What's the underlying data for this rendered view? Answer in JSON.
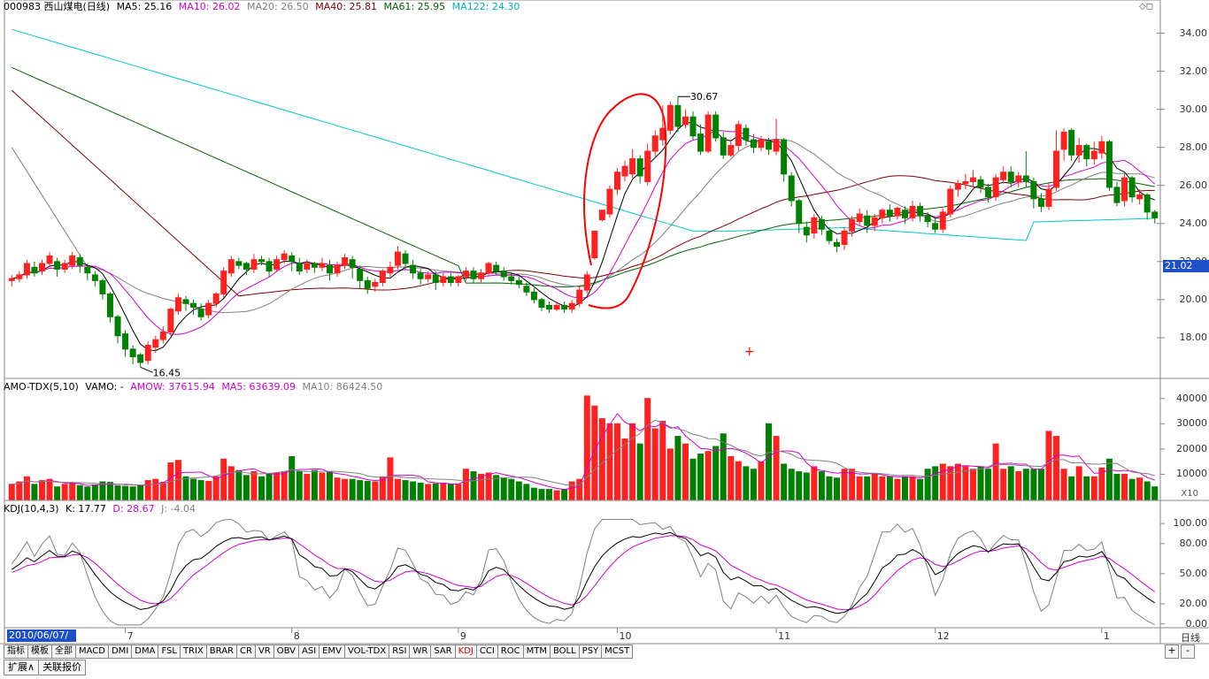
{
  "header": {
    "code_name": "000983 西山煤电(日线)",
    "ma5": "MA5: 25.16",
    "ma10": "MA10: 26.02",
    "ma20": "MA20: 26.50",
    "ma40": "MA40: 25.81",
    "ma61": "MA61: 25.95",
    "ma122": "MA122: 24.30"
  },
  "volume_header": {
    "name": "AMO-TDX(5,10)",
    "vamo": "VAMO: -",
    "amow": "AMOW: 37615.94",
    "ma5": "MA5: 63639.09",
    "ma10": "MA10: 86424.50"
  },
  "kdj_header": {
    "name": "KDJ(10,4,3)",
    "k": "K: 17.77",
    "d": "D: 28.67",
    "j": "J: -4.04"
  },
  "price_axis": [
    "34.00",
    "32.00",
    "30.00",
    "28.00",
    "26.00",
    "24.00",
    "22.00",
    "20.00",
    "18.00"
  ],
  "current_price": "21.02",
  "high_label": "30.67",
  "low_label": "16.45",
  "volume_axis": [
    "40000",
    "30000",
    "20000",
    "10000"
  ],
  "volume_unit": "X10",
  "kdj_axis": [
    "100.00",
    "80.00",
    "50.00",
    "20.00",
    "0.00"
  ],
  "x_months": [
    "7",
    "8",
    "9",
    "10",
    "11",
    "12",
    "1"
  ],
  "start_date": "2010/06/07/—",
  "period_label": "日线",
  "indicator_tabs": [
    "指标",
    "模板",
    "全部",
    "MACD",
    "DMI",
    "DMA",
    "FSL",
    "TRIX",
    "BRAR",
    "CR",
    "VR",
    "OBV",
    "ASI",
    "EMV",
    "VOL-TDX",
    "RSI",
    "WR",
    "SAR",
    "KDJ",
    "CCI",
    "ROC",
    "MTM",
    "BOLL",
    "PSY",
    "MCST"
  ],
  "active_tab": "KDJ",
  "bottom_tabs": [
    "扩展∧",
    "关联报价"
  ],
  "right_controls": [
    "+",
    "-"
  ],
  "colors": {
    "up": "#ff2020",
    "down": "#008000",
    "ma5": "#000000",
    "ma10": "#d000d0",
    "ma20": "#808080",
    "ma40": "#800000",
    "ma61": "#006400",
    "ma122": "#00c8d0",
    "accent": "#1e50c8"
  },
  "chart_data": {
    "type": "candlestick",
    "title": "000983 西山煤电(日线)",
    "ylim": [
      16,
      35
    ],
    "candles": [
      [
        21.0,
        21.1,
        20.7,
        21.3
      ],
      [
        21.1,
        21.3,
        20.9,
        21.5
      ],
      [
        21.3,
        21.9,
        21.1,
        22.1
      ],
      [
        21.7,
        21.4,
        21.2,
        22.0
      ],
      [
        21.5,
        21.9,
        21.3,
        22.1
      ],
      [
        21.9,
        22.3,
        21.7,
        22.5
      ],
      [
        22.0,
        21.6,
        21.2,
        22.2
      ],
      [
        21.6,
        21.9,
        21.4,
        22.1
      ],
      [
        21.8,
        22.3,
        21.6,
        22.5
      ],
      [
        22.2,
        21.8,
        21.4,
        22.4
      ],
      [
        21.7,
        21.4,
        21.0,
        21.9
      ],
      [
        21.3,
        21.0,
        20.7,
        21.5
      ],
      [
        21.0,
        20.3,
        20.0,
        21.1
      ],
      [
        20.3,
        19.1,
        18.8,
        20.4
      ],
      [
        19.1,
        18.1,
        17.7,
        19.2
      ],
      [
        18.2,
        17.4,
        17.0,
        18.4
      ],
      [
        17.4,
        17.0,
        16.6,
        17.6
      ],
      [
        17.1,
        16.7,
        16.45,
        17.2
      ],
      [
        16.8,
        17.6,
        16.6,
        17.8
      ],
      [
        17.5,
        17.9,
        17.2,
        18.1
      ],
      [
        17.9,
        18.3,
        17.7,
        18.6
      ],
      [
        18.3,
        19.5,
        18.1,
        19.6
      ],
      [
        19.4,
        20.1,
        19.2,
        20.3
      ],
      [
        20.0,
        19.8,
        19.4,
        20.2
      ],
      [
        19.8,
        19.6,
        19.2,
        20.0
      ],
      [
        19.5,
        19.1,
        18.9,
        19.8
      ],
      [
        19.2,
        19.8,
        19.0,
        20.0
      ],
      [
        19.8,
        20.3,
        19.6,
        20.4
      ],
      [
        20.3,
        21.5,
        20.1,
        21.7
      ],
      [
        21.4,
        22.1,
        21.2,
        22.3
      ],
      [
        22.0,
        21.8,
        21.6,
        22.2
      ],
      [
        21.9,
        21.6,
        21.3,
        22.0
      ],
      [
        21.6,
        22.1,
        21.4,
        22.4
      ],
      [
        22.1,
        22.0,
        21.8,
        22.3
      ],
      [
        22.0,
        21.5,
        21.2,
        22.2
      ],
      [
        21.6,
        22.1,
        21.5,
        22.3
      ],
      [
        22.1,
        22.4,
        21.9,
        22.6
      ],
      [
        22.3,
        22.0,
        21.5,
        22.5
      ],
      [
        21.9,
        21.5,
        21.3,
        22.2
      ],
      [
        21.6,
        21.9,
        21.4,
        22.1
      ],
      [
        21.9,
        21.7,
        21.4,
        22.0
      ],
      [
        21.7,
        21.9,
        21.5,
        22.2
      ],
      [
        21.8,
        21.4,
        21.0,
        22.1
      ],
      [
        21.4,
        21.8,
        21.2,
        22.0
      ],
      [
        21.8,
        22.2,
        21.6,
        22.4
      ],
      [
        22.1,
        21.7,
        21.1,
        22.3
      ],
      [
        21.6,
        21.0,
        20.6,
        21.8
      ],
      [
        21.0,
        20.6,
        20.3,
        21.2
      ],
      [
        20.7,
        20.9,
        20.4,
        21.1
      ],
      [
        20.9,
        21.5,
        20.7,
        21.6
      ],
      [
        21.4,
        21.7,
        21.2,
        22.0
      ],
      [
        21.8,
        22.5,
        21.6,
        22.8
      ],
      [
        22.4,
        21.9,
        21.6,
        22.6
      ],
      [
        21.8,
        21.4,
        21.1,
        22.1
      ],
      [
        21.4,
        21.1,
        20.8,
        21.6
      ],
      [
        21.1,
        21.3,
        20.9,
        21.5
      ],
      [
        21.3,
        20.9,
        20.5,
        21.5
      ],
      [
        20.9,
        21.2,
        20.7,
        21.4
      ],
      [
        21.2,
        20.9,
        20.7,
        21.4
      ],
      [
        20.9,
        21.2,
        20.7,
        21.3
      ],
      [
        21.2,
        21.5,
        21.0,
        21.7
      ],
      [
        21.5,
        21.1,
        20.9,
        21.7
      ],
      [
        21.1,
        21.4,
        20.9,
        21.6
      ],
      [
        21.4,
        21.9,
        21.2,
        22.0
      ],
      [
        21.8,
        21.5,
        21.3,
        22.0
      ],
      [
        21.5,
        21.2,
        21.0,
        21.7
      ],
      [
        21.2,
        21.0,
        20.8,
        21.4
      ],
      [
        21.0,
        20.8,
        20.6,
        21.2
      ],
      [
        20.7,
        20.4,
        20.2,
        20.9
      ],
      [
        20.4,
        20.0,
        19.8,
        20.6
      ],
      [
        20.0,
        19.6,
        19.4,
        20.1
      ],
      [
        19.7,
        19.5,
        19.3,
        19.9
      ],
      [
        19.5,
        19.7,
        19.4,
        19.9
      ],
      [
        19.7,
        19.5,
        19.3,
        19.9
      ],
      [
        19.5,
        19.8,
        19.3,
        20.0
      ],
      [
        19.8,
        20.5,
        19.6,
        20.7
      ],
      [
        20.5,
        21.3,
        20.3,
        21.5
      ],
      [
        22.2,
        23.6,
        22.1,
        23.6
      ],
      [
        24.2,
        24.7,
        24.1,
        24.7
      ],
      [
        24.5,
        25.8,
        24.3,
        26.0
      ],
      [
        25.8,
        26.7,
        25.5,
        26.9
      ],
      [
        26.5,
        27.0,
        26.2,
        27.3
      ],
      [
        26.6,
        27.4,
        26.4,
        27.9
      ],
      [
        27.4,
        26.5,
        26.1,
        27.6
      ],
      [
        26.2,
        27.8,
        26.0,
        28.2
      ],
      [
        27.8,
        28.6,
        27.5,
        28.9
      ],
      [
        28.4,
        29.0,
        28.1,
        30.2
      ],
      [
        28.9,
        30.2,
        28.7,
        30.4
      ],
      [
        30.2,
        29.1,
        28.8,
        30.67
      ],
      [
        29.2,
        29.6,
        29.0,
        30.0
      ],
      [
        29.6,
        28.6,
        28.4,
        29.9
      ],
      [
        28.7,
        27.8,
        27.6,
        29.2
      ],
      [
        27.8,
        29.7,
        27.7,
        29.9
      ],
      [
        29.7,
        28.5,
        28.3,
        29.9
      ],
      [
        28.5,
        27.6,
        27.4,
        28.8
      ],
      [
        27.6,
        28.1,
        27.5,
        28.4
      ],
      [
        28.1,
        29.2,
        27.8,
        29.4
      ],
      [
        29.0,
        28.4,
        28.1,
        29.2
      ],
      [
        28.4,
        28.0,
        27.7,
        28.7
      ],
      [
        28.0,
        28.4,
        27.8,
        28.6
      ],
      [
        28.3,
        27.9,
        27.6,
        28.5
      ],
      [
        27.8,
        28.4,
        27.6,
        29.5
      ],
      [
        28.4,
        26.6,
        26.2,
        28.5
      ],
      [
        26.5,
        25.2,
        24.9,
        26.7
      ],
      [
        25.2,
        24.0,
        23.5,
        25.3
      ],
      [
        23.8,
        23.4,
        23.0,
        24.1
      ],
      [
        23.5,
        24.3,
        23.2,
        24.5
      ],
      [
        24.2,
        23.7,
        23.4,
        24.4
      ],
      [
        23.6,
        23.1,
        22.9,
        23.8
      ],
      [
        23.0,
        22.8,
        22.5,
        23.2
      ],
      [
        22.9,
        23.6,
        22.6,
        23.8
      ],
      [
        23.6,
        24.2,
        23.3,
        24.4
      ],
      [
        24.1,
        24.5,
        23.9,
        24.8
      ],
      [
        24.4,
        23.9,
        23.5,
        24.7
      ],
      [
        23.9,
        24.3,
        23.6,
        24.5
      ],
      [
        24.3,
        24.7,
        24.0,
        24.8
      ],
      [
        24.7,
        24.4,
        24.1,
        25.0
      ],
      [
        24.4,
        24.8,
        24.2,
        24.9
      ],
      [
        24.7,
        24.3,
        24.0,
        24.9
      ],
      [
        24.3,
        24.9,
        24.1,
        25.2
      ],
      [
        24.9,
        24.4,
        24.1,
        25.1
      ],
      [
        24.4,
        24.1,
        23.8,
        24.6
      ],
      [
        24.0,
        23.7,
        23.5,
        24.3
      ],
      [
        23.7,
        24.6,
        23.5,
        24.8
      ],
      [
        24.5,
        25.8,
        24.3,
        26.0
      ],
      [
        25.8,
        26.1,
        25.4,
        26.3
      ],
      [
        26.1,
        26.2,
        25.8,
        26.6
      ],
      [
        26.2,
        26.4,
        25.9,
        26.8
      ],
      [
        26.3,
        25.9,
        25.6,
        26.5
      ],
      [
        25.9,
        25.4,
        25.1,
        26.1
      ],
      [
        25.4,
        26.4,
        25.2,
        26.6
      ],
      [
        26.3,
        26.7,
        26.1,
        27.0
      ],
      [
        26.7,
        26.2,
        25.9,
        27.0
      ],
      [
        26.2,
        26.5,
        25.9,
        26.7
      ],
      [
        26.5,
        26.2,
        25.9,
        27.8
      ],
      [
        26.2,
        25.3,
        24.8,
        26.4
      ],
      [
        25.3,
        24.9,
        24.6,
        25.6
      ],
      [
        24.9,
        25.8,
        24.7,
        26.1
      ],
      [
        25.9,
        27.8,
        25.7,
        28.9
      ],
      [
        27.9,
        28.8,
        27.3,
        29.0
      ],
      [
        28.9,
        27.6,
        27.3,
        29.0
      ],
      [
        27.6,
        28.1,
        27.2,
        28.5
      ],
      [
        28.1,
        27.4,
        27.0,
        28.2
      ],
      [
        27.4,
        27.8,
        27.1,
        28.3
      ],
      [
        27.7,
        28.3,
        27.4,
        28.6
      ],
      [
        28.3,
        25.9,
        25.7,
        28.4
      ],
      [
        25.9,
        25.1,
        24.9,
        26.2
      ],
      [
        25.2,
        26.4,
        24.9,
        26.6
      ],
      [
        26.4,
        25.4,
        25.1,
        26.5
      ],
      [
        25.3,
        25.5,
        25.0,
        25.8
      ],
      [
        25.5,
        24.6,
        24.2,
        25.6
      ],
      [
        24.6,
        24.3,
        24.0,
        24.7
      ]
    ],
    "volumes": [
      6000,
      7000,
      9000,
      6000,
      7500,
      8000,
      5000,
      6000,
      6500,
      5500,
      5000,
      5800,
      7000,
      6800,
      5400,
      5200,
      5000,
      5600,
      7500,
      8000,
      6800,
      14500,
      15500,
      9000,
      8000,
      7500,
      7200,
      9000,
      16000,
      13000,
      11500,
      9500,
      11000,
      9000,
      10000,
      10500,
      11000,
      17000,
      11000,
      10000,
      11500,
      10500,
      11000,
      8500,
      8000,
      8000,
      7500,
      7200,
      7000,
      9000,
      16500,
      8000,
      7500,
      7000,
      6500,
      6000,
      6200,
      6500,
      6000,
      6000,
      12000,
      11000,
      10000,
      10500,
      9500,
      8500,
      8000,
      7000,
      6000,
      4500,
      4000,
      4000,
      3500,
      4000,
      7000,
      8000,
      41000,
      37000,
      32000,
      30000,
      30000,
      24000,
      30000,
      22000,
      40000,
      28000,
      31000,
      20000,
      25000,
      22000,
      16000,
      18000,
      19000,
      21000,
      26000,
      17000,
      15000,
      13000,
      12000,
      15000,
      30000,
      25000,
      14000,
      12000,
      11000,
      10500,
      13000,
      11000,
      9000,
      8500,
      12000,
      12000,
      9000,
      9000,
      10000,
      9000,
      9000,
      8000,
      9000,
      9000,
      8000,
      12000,
      13000,
      14000,
      13000,
      14000,
      13000,
      12000,
      13000,
      12000,
      22000,
      12000,
      13000,
      11000,
      12000,
      12000,
      12000,
      27000,
      25000,
      12000,
      9000,
      13000,
      9000,
      9000,
      12500,
      16000,
      10000,
      10000,
      8000,
      8500,
      7000,
      5000
    ]
  }
}
